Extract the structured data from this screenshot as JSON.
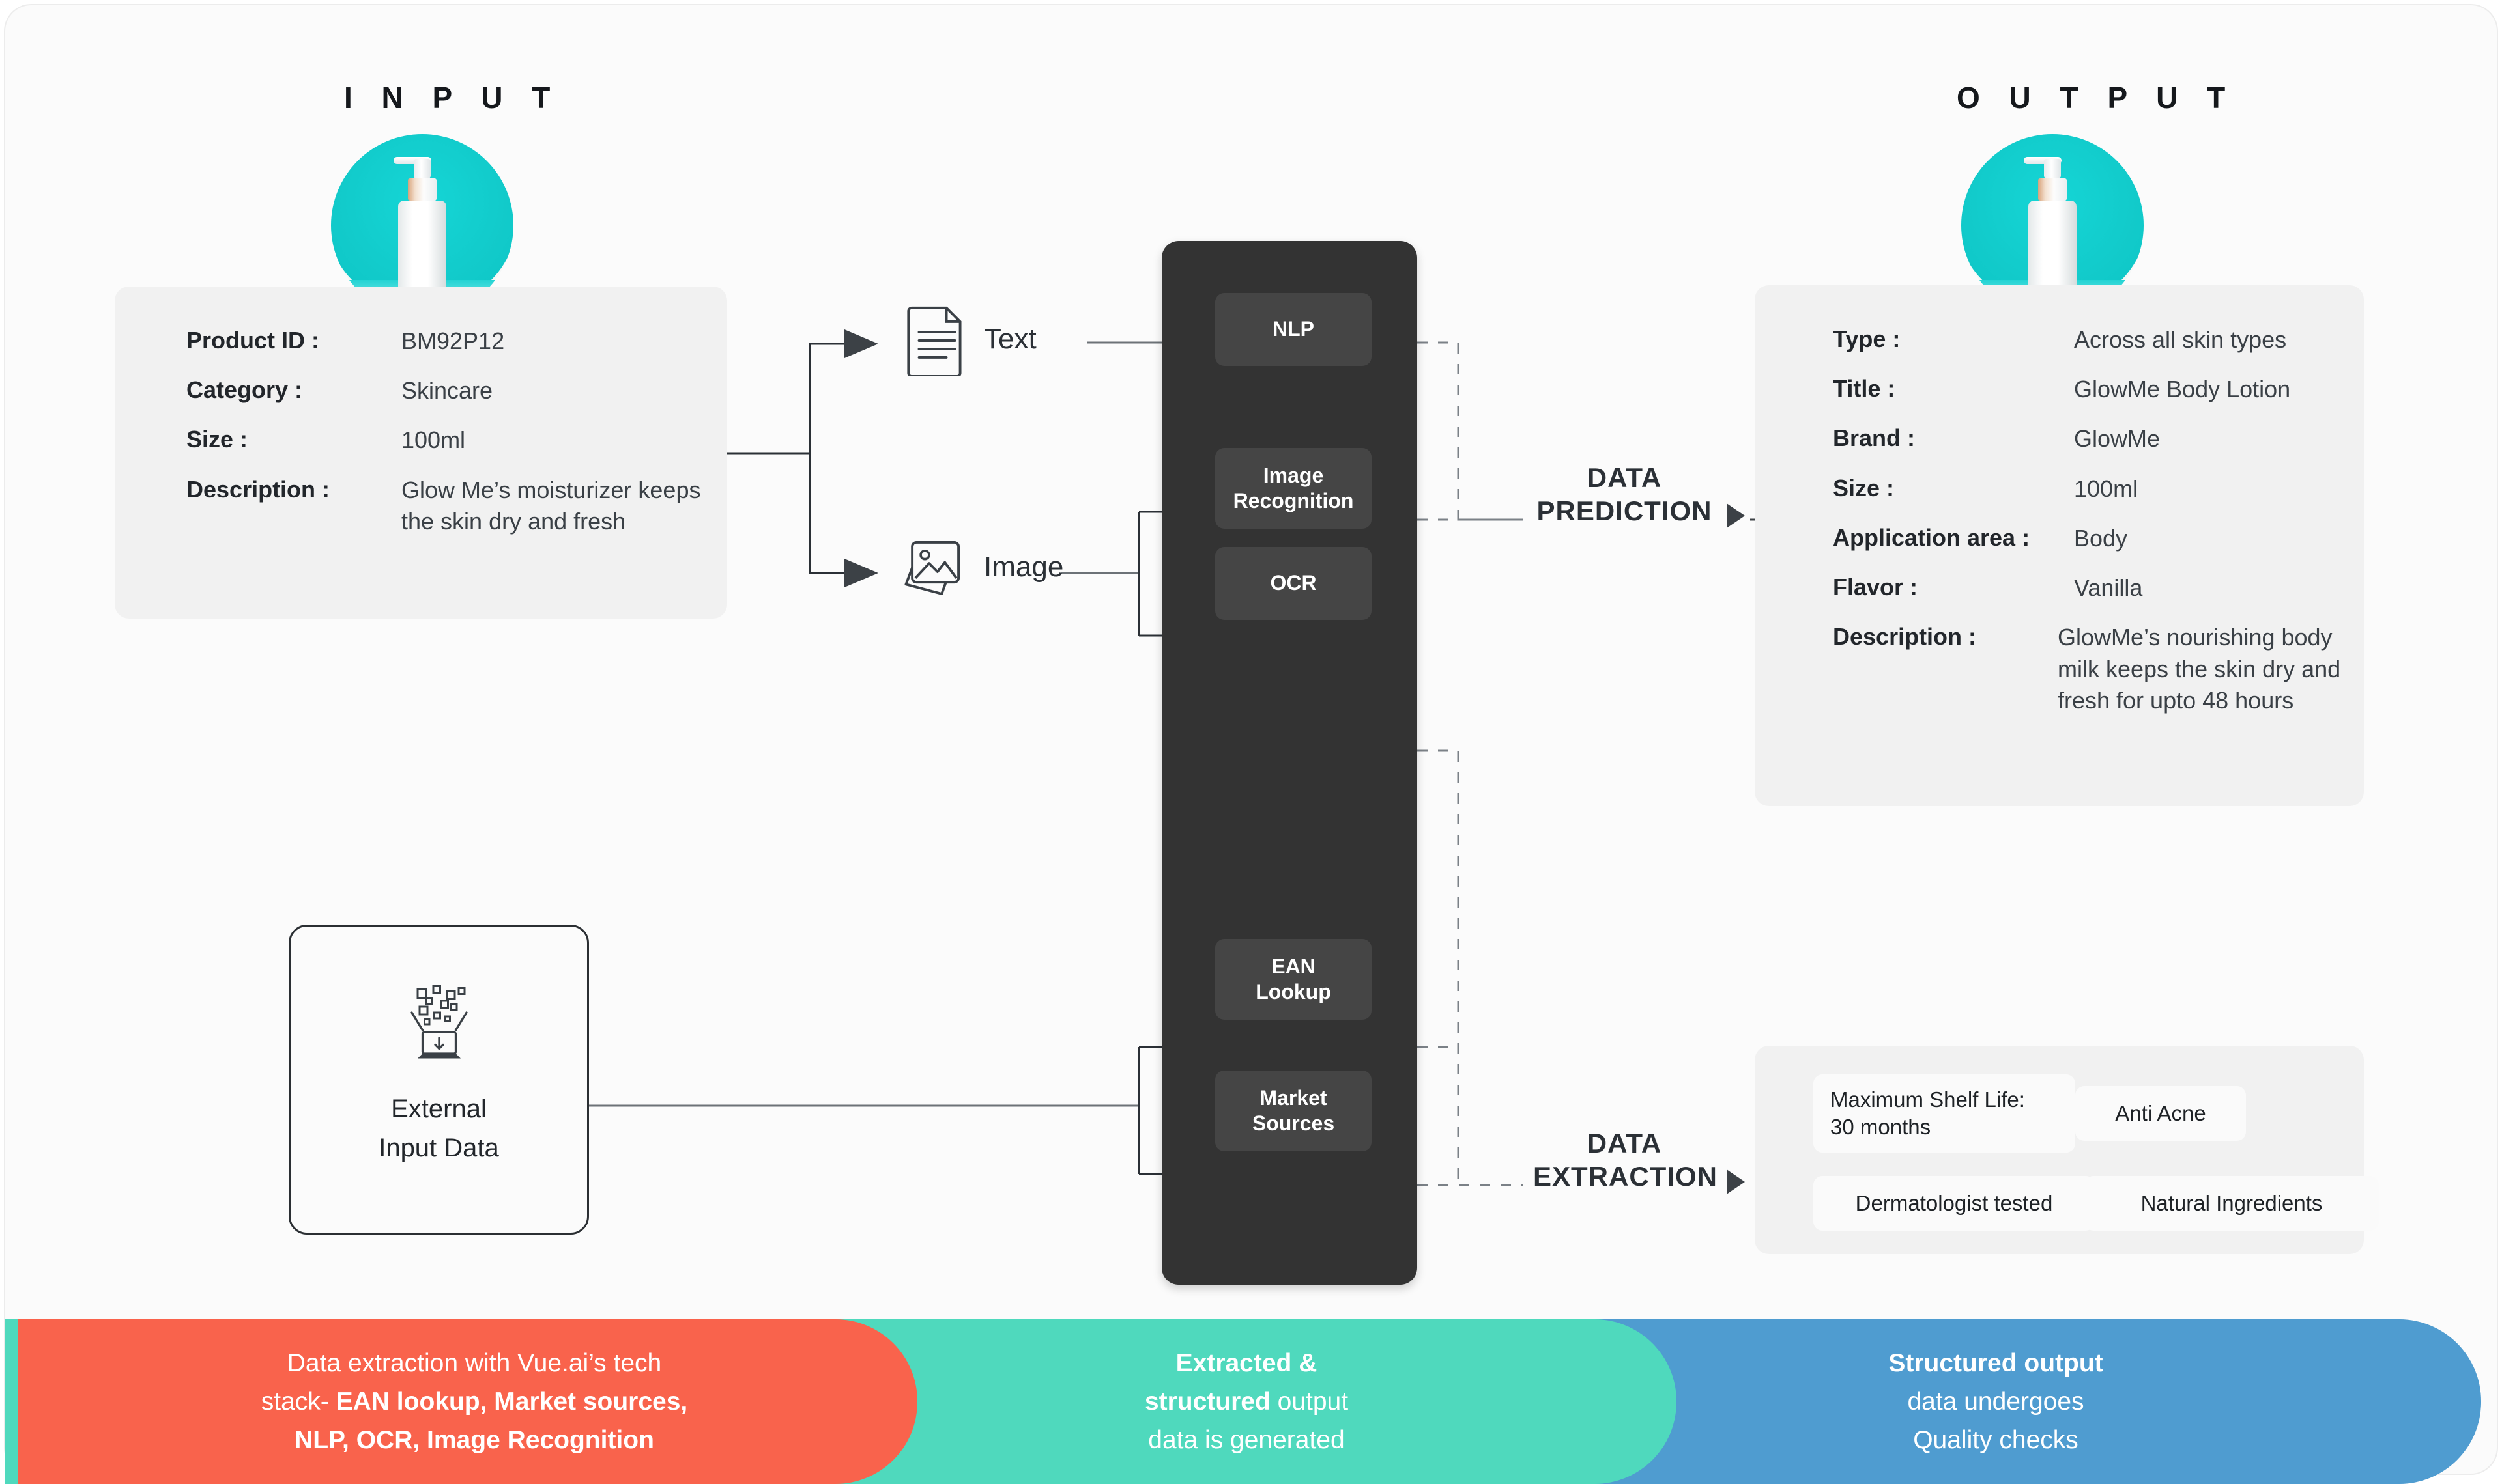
{
  "sections": {
    "input_title": "I N P U T",
    "output_title": "O U T P U T"
  },
  "input_panel": {
    "rows": [
      {
        "label": "Product ID :",
        "value": "BM92P12"
      },
      {
        "label": "Category :",
        "value": "Skincare"
      },
      {
        "label": "Size :",
        "value": "100ml"
      },
      {
        "label": "Description :",
        "value": "Glow Me’s moisturizer keeps the skin dry and fresh"
      }
    ]
  },
  "output_panel": {
    "rows": [
      {
        "label": "Type :",
        "value": "Across all skin types"
      },
      {
        "label": "Title :",
        "value": "GlowMe Body Lotion"
      },
      {
        "label": "Brand :",
        "value": "GlowMe"
      },
      {
        "label": "Size :",
        "value": "100ml"
      },
      {
        "label": "Application area :",
        "value": "Body"
      },
      {
        "label": "Flavor :",
        "value": "Vanilla"
      },
      {
        "label": "Description :",
        "value": "GlowMe’s nourishing body milk keeps the skin dry and fresh for upto 48 hours"
      }
    ]
  },
  "external_input": {
    "label": "External\nInput Data",
    "icon": "data-import-icon"
  },
  "modalities": [
    {
      "label": "Text",
      "icon": "document-icon"
    },
    {
      "label": "Image",
      "icon": "photos-icon"
    }
  ],
  "engine": {
    "chips": [
      {
        "label": "NLP"
      },
      {
        "label": "Image\nRecognition"
      },
      {
        "label": "OCR"
      },
      {
        "label": "EAN\nLookup"
      },
      {
        "label": "Market\nSources"
      }
    ]
  },
  "flows": [
    {
      "label": "DATA\nPREDICTION"
    },
    {
      "label": "DATA\nEXTRACTION"
    }
  ],
  "tags": [
    {
      "label": "Maximum Shelf Life:\n30 months"
    },
    {
      "label": "Anti Acne"
    },
    {
      "label": "Dermatologist tested"
    },
    {
      "label": "Natural Ingredients"
    }
  ],
  "ribbon": [
    {
      "color": "#f9634c",
      "line1_normal": "Data extraction with Vue.ai’s tech",
      "line2_normal": "stack- ",
      "line2_bold": "EAN lookup, Market sources,",
      "line3_bold": "NLP, OCR, Image Recognition"
    },
    {
      "color": "#4fd9bd",
      "line1_bold": "Extracted &",
      "line2_bold": "structured",
      "line2_normal": " output",
      "line3_normal": "data is generated"
    },
    {
      "color": "#4f9cd0",
      "line1_bold": "Structured output",
      "line2_normal": "data undergoes",
      "line3_normal": "Quality checks"
    }
  ],
  "colors": {
    "accent_teal": "#12cbcb",
    "engine_bg": "#333333",
    "engine_chip": "#454545",
    "panel_bg": "#f1f1f1",
    "ribbon_red": "#f9634c",
    "ribbon_green": "#4fd9bd",
    "ribbon_blue": "#4f9cd0"
  }
}
